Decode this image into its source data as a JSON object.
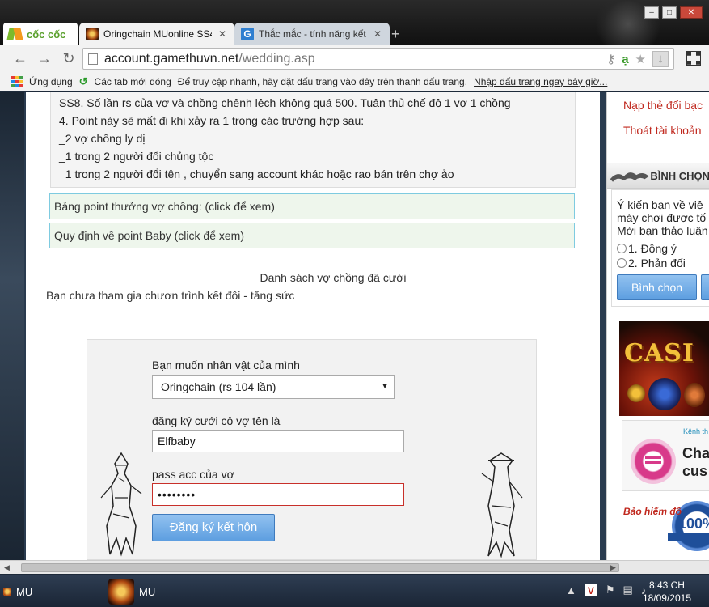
{
  "browser": {
    "brand": "cốc cốc",
    "tabs": [
      {
        "title": "Oringchain MUonline SS4",
        "active": true
      },
      {
        "title": "Thắc mắc - tính năng kết h",
        "active": false
      }
    ],
    "url_host": "account.gamethuvn.net",
    "url_path": "/wedding.asp",
    "bookmarks": {
      "apps": "Ứng dụng",
      "recent_tabs": "Các tab mới đóng",
      "hint": "Để truy cập nhanh, hãy đặt dấu trang vào đây trên thanh dấu trang.",
      "import": "Nhập dấu trang ngay bây giờ..."
    }
  },
  "rules": {
    "lines": [
      "SS8. Số lần rs của vợ và chồng chênh lệch không quá 500. Tuân thủ chế độ 1 vợ 1 chồng",
      "4. Point này sẽ mất đi khi xảy ra 1 trong các trường hợp sau:",
      "_2 vợ chồng ly dị",
      "_1 trong 2 người đổi chủng tộc",
      "_1 trong 2 người đổi tên , chuyển sang account khác hoặc rao bán trên chợ ảo"
    ]
  },
  "toggles": {
    "couple_points": "Bảng point thưởng vợ chồng: (click để xem)",
    "baby_points": "Quy định về point Baby (click để xem)"
  },
  "couples_list_title": "Danh sách vợ chồng đã cưới",
  "not_joined_text": "Bạn chưa tham gia chươn trình kết đôi - tăng sức",
  "form": {
    "character_label": "Bạn muốn nhân vật của mình",
    "character_selected": "Oringchain (rs 104 lần)",
    "wife_name_label": "đăng ký cưới  cô vợ tên là",
    "wife_name_value": "Elfbaby",
    "wife_pass_label": "pass acc của vợ",
    "wife_pass_value": "••••••••",
    "submit_label": "Đăng ký kết hôn"
  },
  "sidebar": {
    "links": [
      "Nạp thẻ đổi bạc",
      "Thoát tài khoản"
    ],
    "poll_title": "BÌNH CHỌN",
    "poll_question_lines": [
      "Ý kiến bạn về việ",
      "máy chơi được tố",
      "Mời bạn thảo luận"
    ],
    "poll_options": [
      "1. Đồng ý",
      "2. Phản đối"
    ],
    "vote_label": "Bình chọn",
    "casino_text": "CASI",
    "chat_small": "Kênh th",
    "chat_word": "Cha",
    "chat_word2": "cus",
    "insurance_text": "Bảo hiểm đồ",
    "seal_text": "100%"
  },
  "taskbar": {
    "items": [
      "MU",
      "MU"
    ],
    "time": "8:43 CH",
    "date": "18/09/2015"
  },
  "colors": {
    "link_red": "#c0281e",
    "toggle_border": "#7ecbe0",
    "button_blue": "#5d9ee0",
    "error_border": "#c8302a"
  }
}
